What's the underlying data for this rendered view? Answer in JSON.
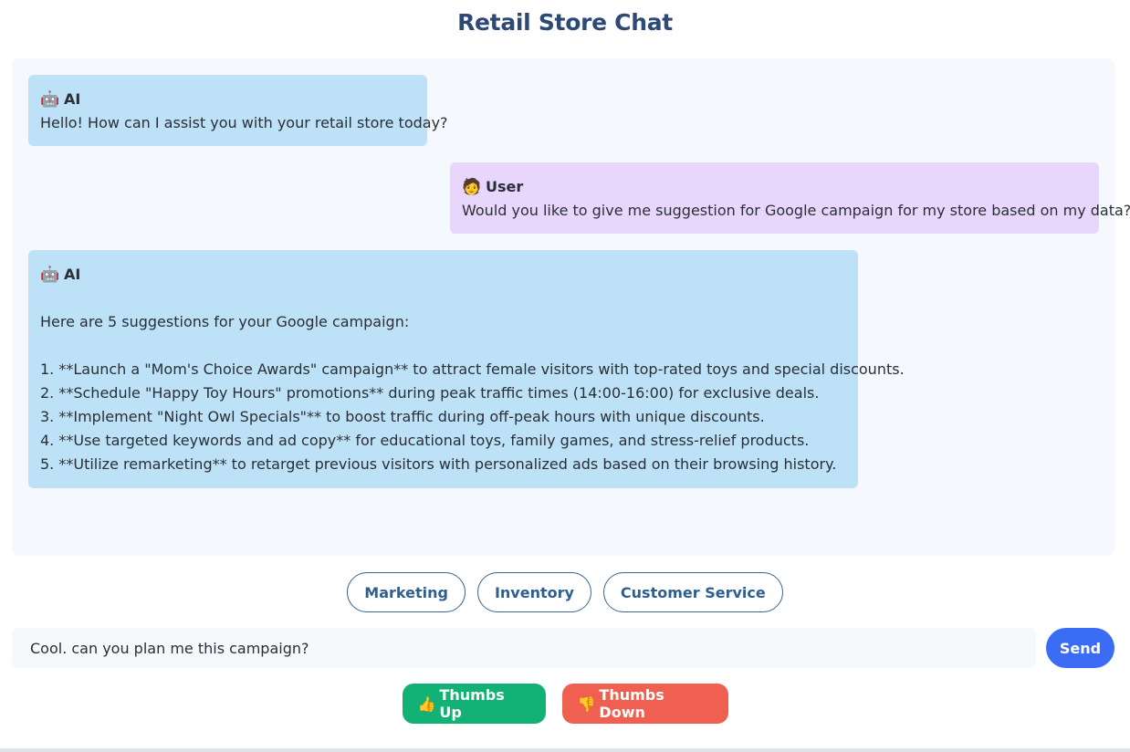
{
  "header": {
    "title": "Retail Store Chat"
  },
  "messages": [
    {
      "role_label": "AI",
      "icon": "robot-icon",
      "emoji": "🤖",
      "lines": [
        "Hello! How can I assist you with your retail store today?"
      ]
    },
    {
      "role_label": "User",
      "icon": "person-icon",
      "emoji": "🧑",
      "lines": [
        "Would you like to give me suggestion for Google campaign for my store based on my data?"
      ]
    },
    {
      "role_label": "AI",
      "icon": "robot-icon",
      "emoji": "🤖",
      "lines": [
        "",
        "Here are 5 suggestions for your Google campaign:",
        "",
        "1. **Launch a \"Mom's Choice Awards\" campaign** to attract female visitors with top-rated toys and special discounts.",
        "2. **Schedule \"Happy Toy Hours\" promotions** during peak traffic times (14:00-16:00) for exclusive deals.",
        "3. **Implement \"Night Owl Specials\"** to boost traffic during off-peak hours with unique discounts.",
        "4. **Use targeted keywords and ad copy** for educational toys, family games, and stress-relief products.",
        "5. **Utilize remarketing** to retarget previous visitors with personalized ads based on their browsing history."
      ]
    }
  ],
  "quick_actions": [
    "Marketing",
    "Inventory",
    "Customer Service"
  ],
  "input": {
    "value": "Cool. can you plan me this campaign?",
    "placeholder": ""
  },
  "send_label": "Send",
  "feedback": {
    "up_emoji": "👍",
    "up_label": "Thumbs Up",
    "down_emoji": "👎",
    "down_label": "Thumbs Down"
  },
  "colors": {
    "title": "#2d4a75",
    "ai_bubble": "#bde1f7",
    "user_bubble": "#e8d6fc",
    "send": "#3a6cf5",
    "thumbs_up": "#12b176",
    "thumbs_down": "#f06050"
  }
}
